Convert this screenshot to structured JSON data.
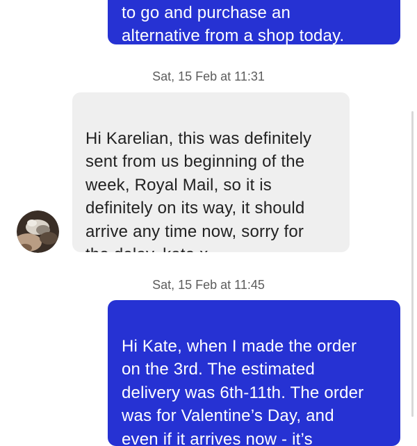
{
  "messages": [
    {
      "direction": "outgoing",
      "text": "to go and purchase an\nalternative from a shop today."
    },
    {
      "direction": "incoming",
      "timestamp": "Sat, 15 Feb at 11:31",
      "text": "Hi Karelian, this was definitely\nsent from us beginning of the\nweek, Royal Mail, so it is\ndefinitely on its way, it should\narrive any time now, sorry for\nthe delay, kate x"
    },
    {
      "direction": "outgoing",
      "timestamp": "Sat, 15 Feb at 11:45",
      "text": "Hi Kate, when I made the order\non the 3rd. The estimated\ndelivery was 6th-11th. The order\nwas for Valentine’s Day, and\neven if it arrives now - it’s"
    }
  ],
  "colors": {
    "outgoing_bubble": "#2632d3",
    "incoming_bubble": "#efefef",
    "timestamp_text": "#5c5c5c"
  },
  "icons": {
    "avatar": "seller-avatar-photo"
  }
}
